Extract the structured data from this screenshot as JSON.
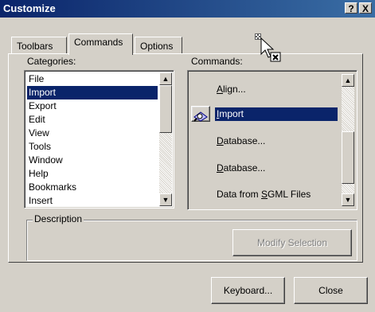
{
  "window": {
    "title": "Customize",
    "help_button": "?",
    "close_button": "X"
  },
  "tabs": [
    {
      "label": "Toolbars",
      "active": false
    },
    {
      "label": "Commands",
      "active": true
    },
    {
      "label": "Options",
      "active": false
    }
  ],
  "categories": {
    "label": "Categories:",
    "items": [
      "File",
      "Import",
      "Export",
      "Edit",
      "View",
      "Tools",
      "Window",
      "Help",
      "Bookmarks",
      "Insert"
    ],
    "selected": "Import"
  },
  "commands": {
    "label": "Commands:",
    "items": [
      {
        "prefix": "",
        "mnemonic": "A",
        "rest": "lign..."
      },
      {
        "prefix": "",
        "mnemonic": "I",
        "rest": "mport"
      },
      {
        "prefix": "",
        "mnemonic": "D",
        "rest": "atabase..."
      },
      {
        "prefix": "",
        "mnemonic": "D",
        "rest": "atabase..."
      },
      {
        "prefix": "Data from ",
        "mnemonic": "S",
        "rest": "GML Files"
      }
    ],
    "selected_index": 1
  },
  "description": {
    "label": "Description",
    "modify_button": "Modify Selection"
  },
  "footer": {
    "keyboard_button": "Keyboard...",
    "close_button": "Close"
  }
}
